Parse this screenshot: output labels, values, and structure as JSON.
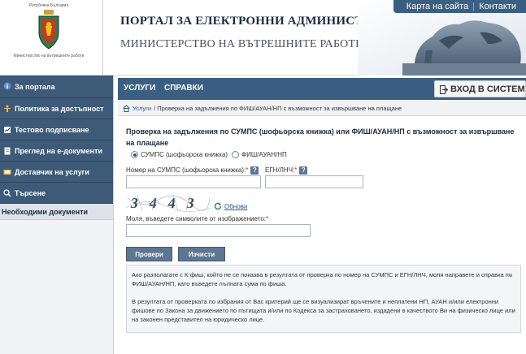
{
  "header": {
    "crest_top": "Република България",
    "crest_bottom": "Министерство на вътрешните работи",
    "portal_title": "ПОРТАЛ ЗА ЕЛЕКТРОННИ АДМИНИСТРАТИВНИ УСЛУГИ",
    "ministry_title": "МИНИСТЕРСТВО НА ВЪТРЕШНИТЕ РАБОТИ",
    "links": {
      "sitemap": "Карта на сайта",
      "contacts": "Контакти"
    }
  },
  "sidebar": {
    "items": [
      {
        "label": "За портала",
        "icon": "info-icon"
      },
      {
        "label": "Политика за достъпност",
        "icon": "accessibility-icon"
      },
      {
        "label": "Тестово подписване",
        "icon": "signature-icon"
      },
      {
        "label": "Преглед на е-документи",
        "icon": "document-icon"
      },
      {
        "label": "Доставчик на услуги",
        "icon": "provider-icon"
      },
      {
        "label": "Търсене",
        "icon": "search-icon"
      }
    ],
    "docs_header": "Необходими документи"
  },
  "mainbar": {
    "tabs": [
      "УСЛУГИ",
      "СПРАВКИ"
    ],
    "login": "ВХОД В СИСТЕМАТА"
  },
  "breadcrumb": {
    "root": "Услуги",
    "current": "/ Проверка на задължения по ФИШ/АУАН/НП с възможност за извършване на плащане"
  },
  "form": {
    "title": "Проверка на задължения по СУМПС (шофьорска книжка) или ФИШ/АУАН/НП с възможност за извършване на плащане",
    "radio_sumps": "СУМПС (шофьорска книжка)",
    "radio_fish": "ФИШ/АУАН/НП",
    "label_sumps": "Номер на СУМПС (шофьорска книжка):",
    "label_egn": "ЕГН/ЛНЧ:",
    "required_mark": "*",
    "help_mark": "?",
    "captcha_text": "3443",
    "refresh": "Обнови",
    "label_captcha": "Моля, въведете символите от изображението:",
    "btn_check": "Провери",
    "btn_clear": "Изчисти"
  },
  "info": {
    "p1": "Ако разполагате с К-фиш, който не се показва в резултата от проверка по номер на СУМПС и ЕГН/ЛНЧ, моля направете и справка по ФИШ/АУАН/НП, като въведете пълната сума по фиша.",
    "p2": "В резултата от проверката по избрания от Вас критерий ще се визуализират връчените и неплатени НП, АУАН и/или електронни фишове по Закона за движението по пътищата и/или по Кодекса за застраховането, издадени в качеството Ви на физическо лице или на законен представител на юридическо лице."
  },
  "colors": {
    "nav_bg": "#3d5a78",
    "topbar_bg": "#3a5f82",
    "active_tab": "#f0c060",
    "button_bg": "#5d7692"
  }
}
